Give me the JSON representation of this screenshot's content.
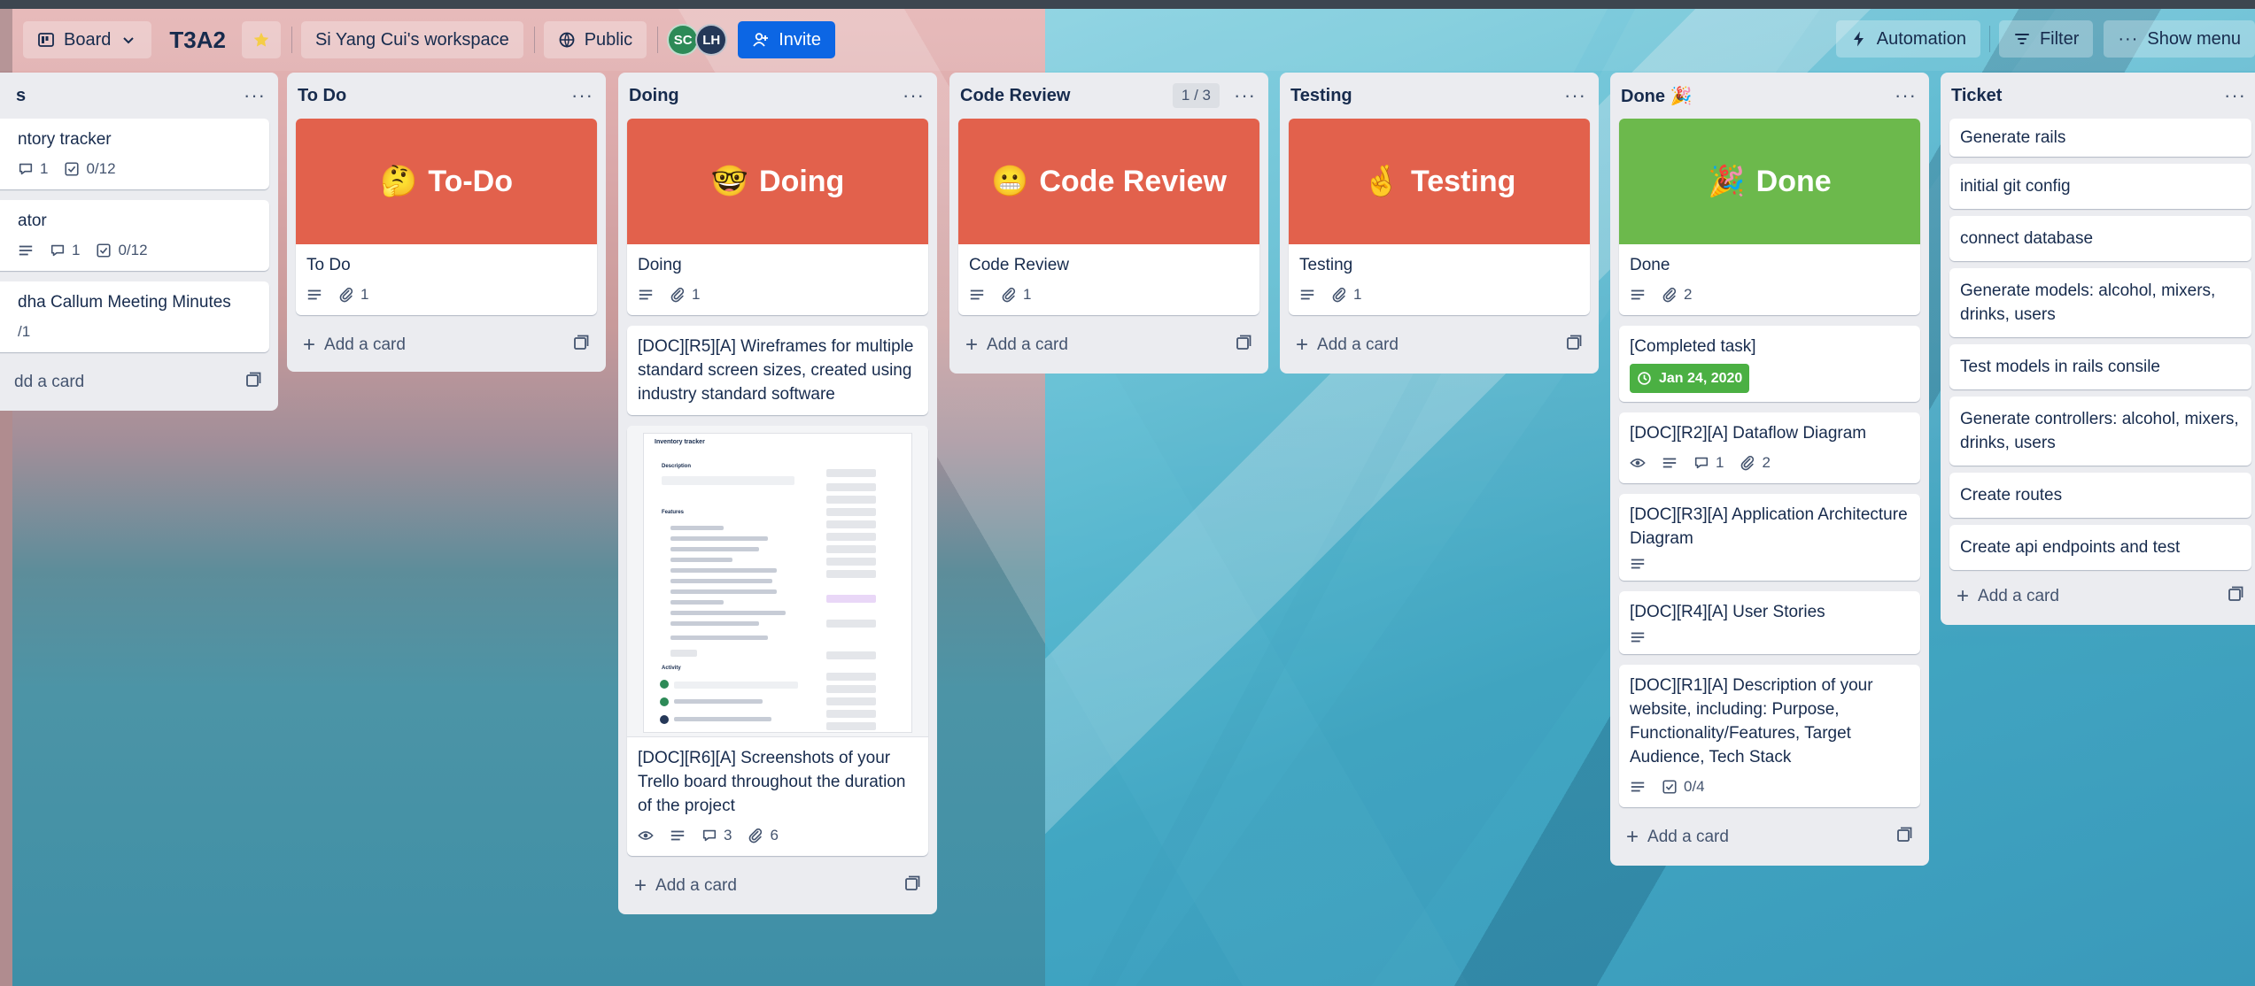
{
  "header": {
    "view_label": "Board",
    "board_title": "T3A2",
    "workspace": "Si Yang Cui's workspace",
    "visibility": "Public",
    "avatars": [
      "SC",
      "LH"
    ],
    "invite_label": "Invite",
    "automation_label": "Automation",
    "filter_label": "Filter",
    "menu_label": "Show menu"
  },
  "colors": {
    "cover_red": "#e2614c",
    "cover_green": "#6cb94c",
    "invite_blue": "#0c66e4",
    "date_green": "#4bb043"
  },
  "lists": {
    "backlog": {
      "title": "s",
      "cards": [
        {
          "title": "ntory tracker",
          "comments": "1",
          "checklist": "0/12"
        },
        {
          "title": "ator",
          "comments": "1",
          "checklist": "0/12"
        },
        {
          "title": "dha Callum Meeting Minutes",
          "checklist": "/1"
        }
      ],
      "add_label": "dd a card"
    },
    "todo": {
      "title": "To Do",
      "cover_emoji": "🤔",
      "cover_text": "To-Do",
      "cards": [
        {
          "title": "To Do",
          "attachments": "1"
        }
      ],
      "add_label": "Add a card"
    },
    "doing": {
      "title": "Doing",
      "cover_emoji": "🤓",
      "cover_text": "Doing",
      "cards": [
        {
          "title": "Doing",
          "attachments": "1"
        },
        {
          "title": "[DOC][R5][A] Wireframes for multiple standard screen sizes, created using industry standard software"
        },
        {
          "title": "[DOC][R6][A] Screenshots of your Trello board throughout the duration of the project",
          "comments": "3",
          "attachments": "6"
        }
      ],
      "screenshot": {
        "title": "Inventory tracker",
        "description_label": "Description",
        "features_label": "Features",
        "activity_label": "Activity"
      },
      "add_label": "Add a card"
    },
    "review": {
      "title": "Code Review",
      "wip": "1 / 3",
      "cover_emoji": "😬",
      "cover_text": "Code Review",
      "cards": [
        {
          "title": "Code Review",
          "attachments": "1"
        }
      ],
      "add_label": "Add a card"
    },
    "testing": {
      "title": "Testing",
      "cover_emoji": "🤞",
      "cover_text": "Testing",
      "cards": [
        {
          "title": "Testing",
          "attachments": "1"
        }
      ],
      "add_label": "Add a card"
    },
    "done": {
      "title": "Done 🎉",
      "cover_emoji": "🎉",
      "cover_text": "Done",
      "cards": [
        {
          "title": "Done",
          "attachments": "2"
        },
        {
          "title": "[Completed task]",
          "date": "Jan 24, 2020"
        },
        {
          "title": "[DOC][R2][A] Dataflow Diagram",
          "comments": "1",
          "attachments": "2"
        },
        {
          "title": "[DOC][R3][A] Application Architecture Diagram"
        },
        {
          "title": "[DOC][R4][A] User Stories"
        },
        {
          "title": "[DOC][R1][A] Description of your website, including: Purpose, Functionality/Features, Target Audience, Tech Stack",
          "checklist": "0/4"
        }
      ],
      "add_label": "Add a card"
    },
    "ticket": {
      "title": "Ticket",
      "cards": [
        "Generate rails",
        "initial git config",
        "connect database",
        "Generate models: alcohol, mixers, drinks, users",
        "Test models in rails consile",
        "Generate controllers: alcohol, mixers, drinks, users",
        "Create routes",
        "Create api endpoints and test"
      ],
      "add_label": "Add a card"
    }
  }
}
